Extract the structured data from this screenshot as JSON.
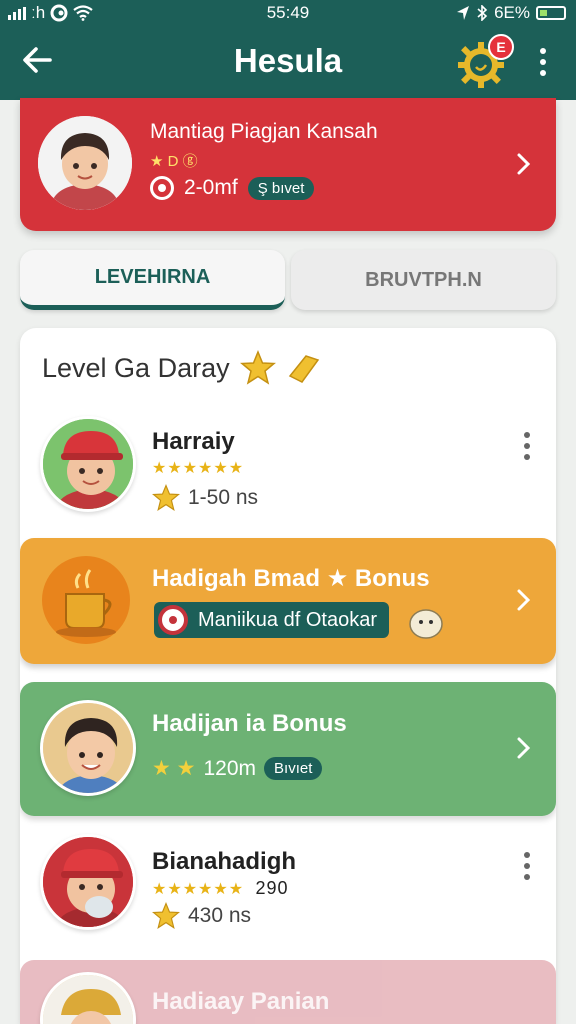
{
  "status_bar": {
    "carrier": "ːh",
    "time": "55:49",
    "battery": "6E%",
    "battery_level": 0.25
  },
  "app_bar": {
    "title": "Hesula",
    "back_icon": "arrow-left-icon",
    "gear_badge": "E",
    "more_icon": "more-vertical-icon"
  },
  "profile": {
    "name": "Mantiag Piagjan Kansah",
    "meta": "★ D ⓖ",
    "stat": "2-0mf",
    "pill": "Ş bıvet"
  },
  "tabs": [
    {
      "label": "LEVEHIRNA",
      "active": true
    },
    {
      "label": "BRUVTPH.N",
      "active": false
    }
  ],
  "section": {
    "title": "Level Ga Daray"
  },
  "entries": [
    {
      "name": "Harraiy",
      "stars": "★★★★★★",
      "stat": "1-50 ns"
    }
  ],
  "bonus_orange": {
    "title": "Hadigah Bmad ★ Bonus",
    "claim_label": "Maniikua df Otaokar"
  },
  "bonus_green": {
    "title": "Hadijan ia Bonus",
    "stars": "★ ★",
    "stat": "120m",
    "pill": "Bıvıet"
  },
  "entry2": {
    "name": "Bianahadigh",
    "stars": "★★★★★★",
    "extra": "290",
    "stat": "430 ns"
  },
  "bonus_pink": {
    "title": "Hadiaay Panian"
  },
  "colors": {
    "primary": "#1c5f58",
    "profile_red": "#d5333a",
    "bonus_orange": "#eea73a",
    "bonus_green": "#6db274",
    "bonus_pink": "#e7b7bd",
    "star_gold": "#e8b317"
  }
}
